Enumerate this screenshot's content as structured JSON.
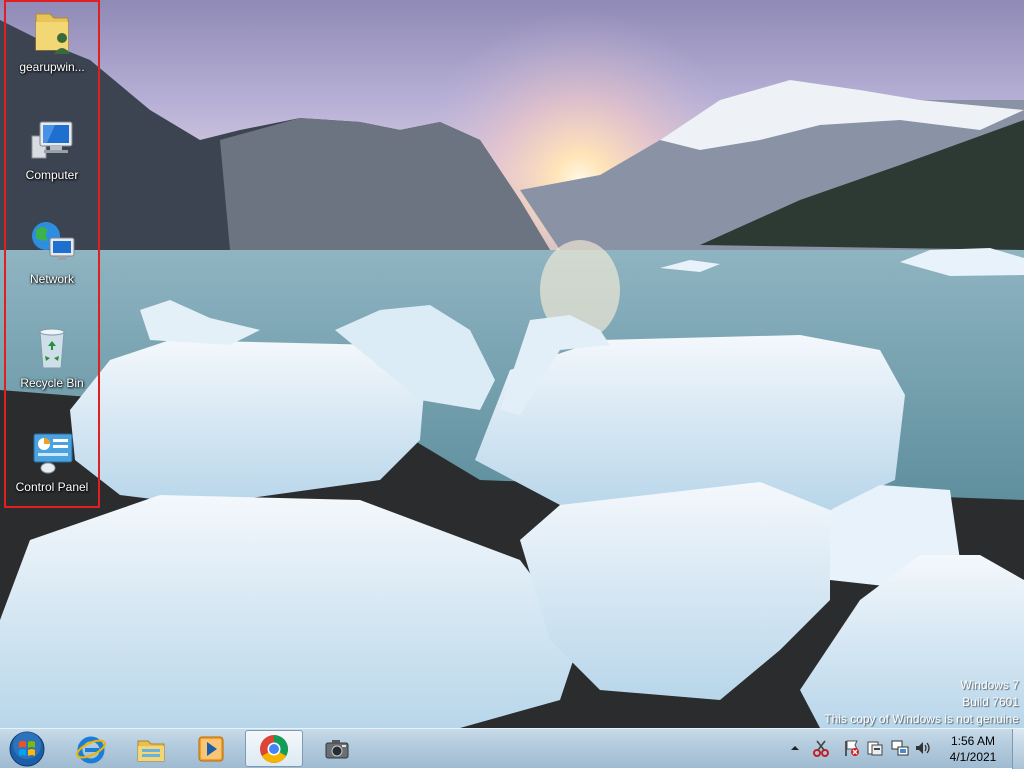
{
  "desktop": {
    "icons": [
      {
        "label": "gearupwin...",
        "icon": "user-folder-icon"
      },
      {
        "label": "Computer",
        "icon": "computer-icon"
      },
      {
        "label": "Network",
        "icon": "network-icon"
      },
      {
        "label": "Recycle Bin",
        "icon": "recycle-bin-icon"
      },
      {
        "label": "Control Panel",
        "icon": "control-panel-icon"
      }
    ],
    "selection_color": "#e02020"
  },
  "watermark": {
    "line1": "Windows 7",
    "line2": "Build 7601",
    "line3": "This copy of Windows is not genuine"
  },
  "taskbar": {
    "pinned": [
      "start-orb-icon",
      "internet-explorer-icon",
      "windows-explorer-icon",
      "media-player-icon",
      "chrome-icon",
      "snipping-camera-icon"
    ],
    "active": "chrome-icon",
    "tray": [
      "show-hidden-icons-arrow",
      "scissors-icon",
      "flag-icon",
      "action-center-icon",
      "network-tray-icon",
      "volume-icon"
    ],
    "clock_time": "1:56 AM",
    "clock_date": "4/1/2021"
  }
}
